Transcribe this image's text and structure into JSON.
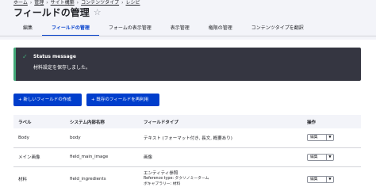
{
  "breadcrumb": [
    "ホーム",
    "管理",
    "サイト構築",
    "コンテンツタイプ",
    "レシピ"
  ],
  "breadcrumb_separator": "›",
  "page": {
    "title": "フィールドの管理",
    "star_icon": "star-icon"
  },
  "tabs": [
    {
      "label": "編集",
      "active": false
    },
    {
      "label": "フィールドの管理",
      "active": true
    },
    {
      "label": "フォームの表示管理",
      "active": false
    },
    {
      "label": "表示管理",
      "active": false
    },
    {
      "label": "権限の管理",
      "active": false
    },
    {
      "label": "コンテンツタイプを翻訳",
      "active": false
    }
  ],
  "status": {
    "icon": "check-icon",
    "title": "Status message",
    "text": "材料設定を保存しました。"
  },
  "buttons": {
    "add_field": "+ 新しいフィールドの作成",
    "reuse_field": "+ 既存のフィールドを再利用"
  },
  "table": {
    "headers": [
      "ラベル",
      "システム内部名称",
      "フィールドタイプ",
      "操作"
    ],
    "rows": [
      {
        "label": "Body",
        "machine": "body",
        "type": "テキスト (フォーマット付き, 長文, 概要あり)",
        "type_sub": [],
        "op": "編集"
      },
      {
        "label": "メイン画像",
        "machine": "field_main_image",
        "type": "画像",
        "type_sub": [],
        "op": "編集"
      },
      {
        "label": "材料",
        "machine": "field_ingredients",
        "type": "エンティティ参照",
        "type_sub": [
          "Reference type: タクソノミーターム",
          "ボキャブラリー: 材料"
        ],
        "op": "編集"
      }
    ]
  },
  "colors": {
    "accent": "#003ecc",
    "status_bg": "#353641",
    "status_ok": "#42a877",
    "header_bg": "#f3f4f9"
  }
}
